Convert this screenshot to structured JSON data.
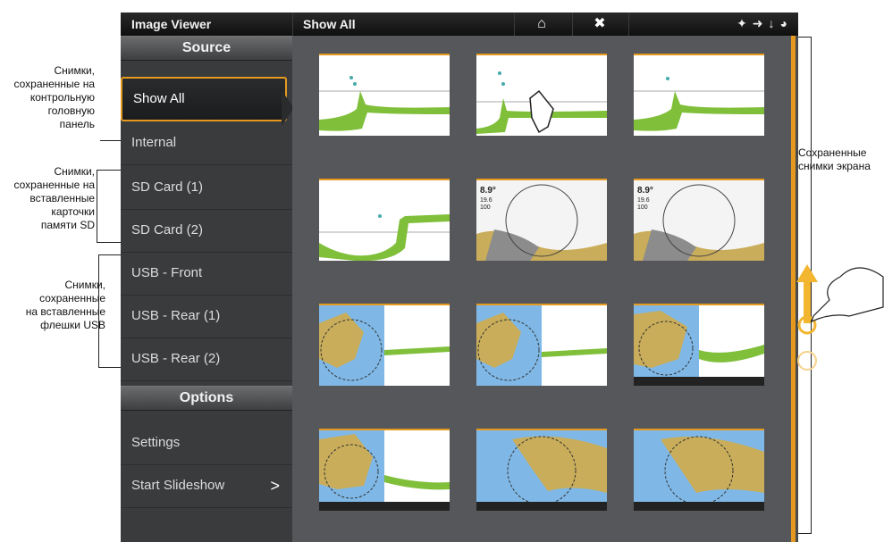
{
  "titlebar": {
    "app_name": "Image Viewer",
    "crumb": "Show All",
    "home_icon": "home-icon",
    "close_icon": "close-icon",
    "status_icons": [
      "gps-icon",
      "pin-icon",
      "download-icon",
      "compass-icon"
    ]
  },
  "sidebar": {
    "source_header": "Source",
    "items": [
      {
        "label": "Show All",
        "selected": true
      },
      {
        "label": "Internal",
        "selected": false
      },
      {
        "label": "SD Card (1)",
        "selected": false
      },
      {
        "label": "SD Card (2)",
        "selected": false
      },
      {
        "label": "USB - Front",
        "selected": false
      },
      {
        "label": "USB - Rear (1)",
        "selected": false
      },
      {
        "label": "USB - Rear (2)",
        "selected": false
      }
    ],
    "options_header": "Options",
    "options": [
      {
        "label": "Settings"
      },
      {
        "label": "Start Slideshow",
        "chevron": ">"
      }
    ]
  },
  "thumbnails": [
    {
      "kind": "sonar"
    },
    {
      "kind": "sonar"
    },
    {
      "kind": "sonar"
    },
    {
      "kind": "sonar"
    },
    {
      "kind": "chart-radar",
      "readout": [
        "8.9°",
        "19.6",
        "100"
      ]
    },
    {
      "kind": "chart-radar",
      "readout": [
        "8.9°",
        "19.6",
        "100"
      ]
    },
    {
      "kind": "chart-split"
    },
    {
      "kind": "chart-split"
    },
    {
      "kind": "chart-split-sonar"
    },
    {
      "kind": "chart-split"
    },
    {
      "kind": "chart-full"
    },
    {
      "kind": "chart-full"
    }
  ],
  "annotations": {
    "head_unit": "Снимки,\nсохраненные на\nконтрольную\nголовную\nпанель",
    "sd_cards": "Снимки,\nсохраненные на\nвставленные\nкарточки\nпамяти SD",
    "usb": "Снимки,\nсохраненные\nна вставленные\nфлешки USB",
    "saved": "Сохраненные\nснимки экрана"
  },
  "colors": {
    "accent": "#e59a1f",
    "water": "#7fb8e6",
    "land": "#c9ad5a",
    "sonar_bottom": "#7fbf3a"
  }
}
